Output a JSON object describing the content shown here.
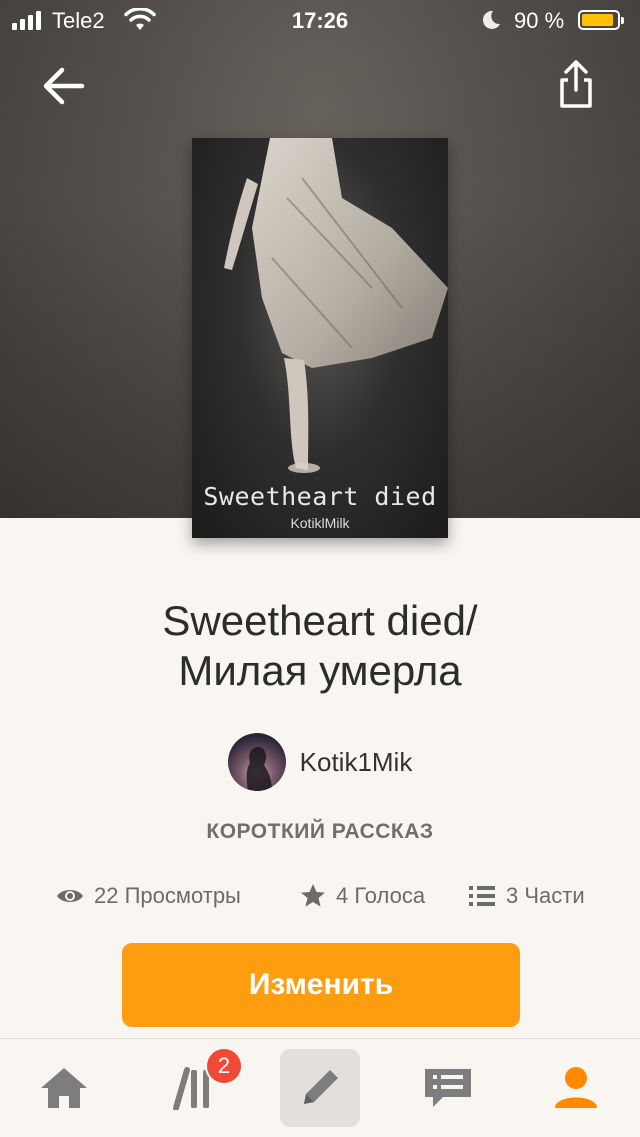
{
  "status_bar": {
    "carrier": "Tele2",
    "time": "17:26",
    "battery_percent": "90 %",
    "battery_level": 0.9
  },
  "header": {
    "back_icon": "arrow-left-icon",
    "share_icon": "share-icon"
  },
  "cover": {
    "title": "Sweetheart died",
    "author": "KotiklMilk"
  },
  "book": {
    "title_line1": "Sweetheart died/",
    "title_line2": "Милая умерла",
    "author": "Kotik1Mik",
    "category": "КОРОТКИЙ РАССКАЗ"
  },
  "stats": {
    "views": "22 Просмотры",
    "votes": "4 Голоса",
    "parts": "3 Части"
  },
  "actions": {
    "edit_label": "Изменить"
  },
  "tabbar": {
    "items": [
      {
        "icon": "home-icon"
      },
      {
        "icon": "library-icon",
        "badge": "2"
      },
      {
        "icon": "pencil-icon"
      },
      {
        "icon": "messages-icon"
      },
      {
        "icon": "profile-icon"
      }
    ]
  },
  "colors": {
    "accent": "#ff9d10",
    "badge": "#ef4a35",
    "profile_active": "#ff8a00"
  }
}
